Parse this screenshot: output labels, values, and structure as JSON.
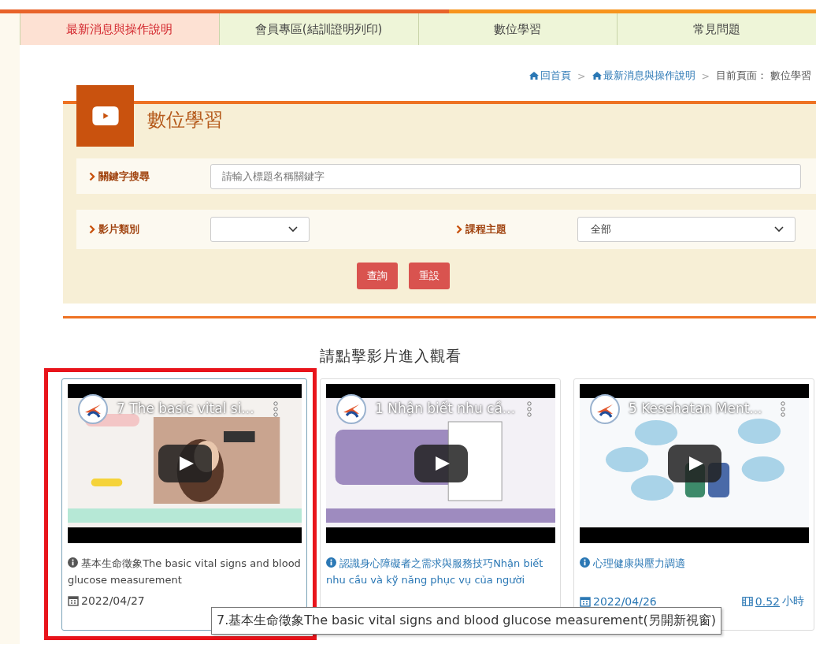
{
  "nav": {
    "tabs": [
      {
        "label": "最新消息與操作說明",
        "selected": true
      },
      {
        "label": "會員專區(結訓證明列印)",
        "selected": false
      },
      {
        "label": "數位學習",
        "selected": false
      },
      {
        "label": "常見問題",
        "selected": false
      }
    ]
  },
  "breadcrumb": {
    "home": "回首頁",
    "separator_1": ">",
    "parent": "最新消息與操作說明",
    "separator_2": ">",
    "current_label": "目前頁面：",
    "current": "數位學習"
  },
  "panel": {
    "title": "數位學習",
    "keyword": {
      "label": "關鍵字搜尋",
      "placeholder": "請輸入標題名稱關鍵字"
    },
    "category": {
      "label": "影片類別"
    },
    "topic": {
      "label": "課程主題",
      "value": "全部"
    },
    "buttons": [
      "查詢",
      "重設"
    ]
  },
  "prompt": "請點擊影片進入觀看",
  "videos": [
    {
      "overlay_title": "7 The basic vital si...",
      "title": "基本生命徵象The basic vital signs and blood glucose measurement",
      "date": "2022/04/27",
      "highlighted": true
    },
    {
      "overlay_title": "1 Nhận biết nhu cầ...",
      "title": "認識身心障礙者之需求與服務技巧Nhận biết nhu cầu và kỹ năng phục vụ của người",
      "highlighted": false
    },
    {
      "overlay_title": "5 Kesehatan Ment...",
      "title": "心理健康與壓力調適",
      "date": "2022/04/26",
      "duration": "0.52",
      "duration_unit": "小時",
      "highlighted": false
    }
  ],
  "tooltip": "7.基本生命徵象The basic vital signs and blood glucose measurement(另開新視窗)"
}
